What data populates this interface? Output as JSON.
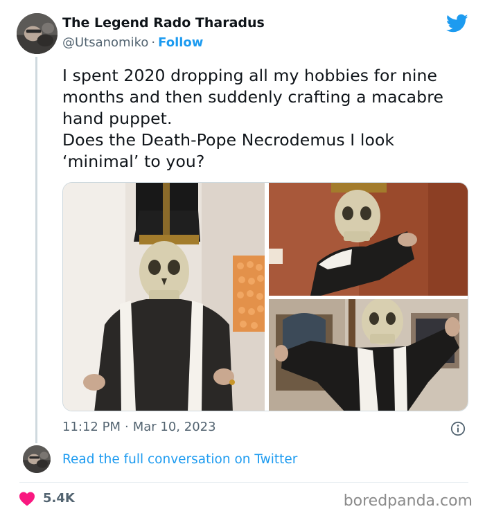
{
  "author": {
    "name": "The Legend Rado Tharadus",
    "handle": "@Utsanomiko",
    "separator": "·",
    "follow_label": "Follow"
  },
  "tweet": {
    "text_lines": [
      "I spent 2020 dropping all my hobbies for nine months and then suddenly crafting a macabre hand puppet.",
      "Does the Death-Pope Necrodemus I look ‘minimal’ to you?"
    ],
    "time": "11:12 PM",
    "date_separator": "·",
    "date": "Mar 10, 2023"
  },
  "thread": {
    "read_more_label": "Read the full conversation on Twitter"
  },
  "engagement": {
    "likes": "5.4K"
  },
  "watermark": "boredpanda.com",
  "icons": {
    "brand": "twitter-bird-icon",
    "info": "info-circle-icon",
    "like": "heart-icon"
  },
  "colors": {
    "accent": "#1d9bf0",
    "text_primary": "#0f1419",
    "text_secondary": "#536471",
    "like": "#f91880",
    "thread_line": "#cfd9de"
  }
}
